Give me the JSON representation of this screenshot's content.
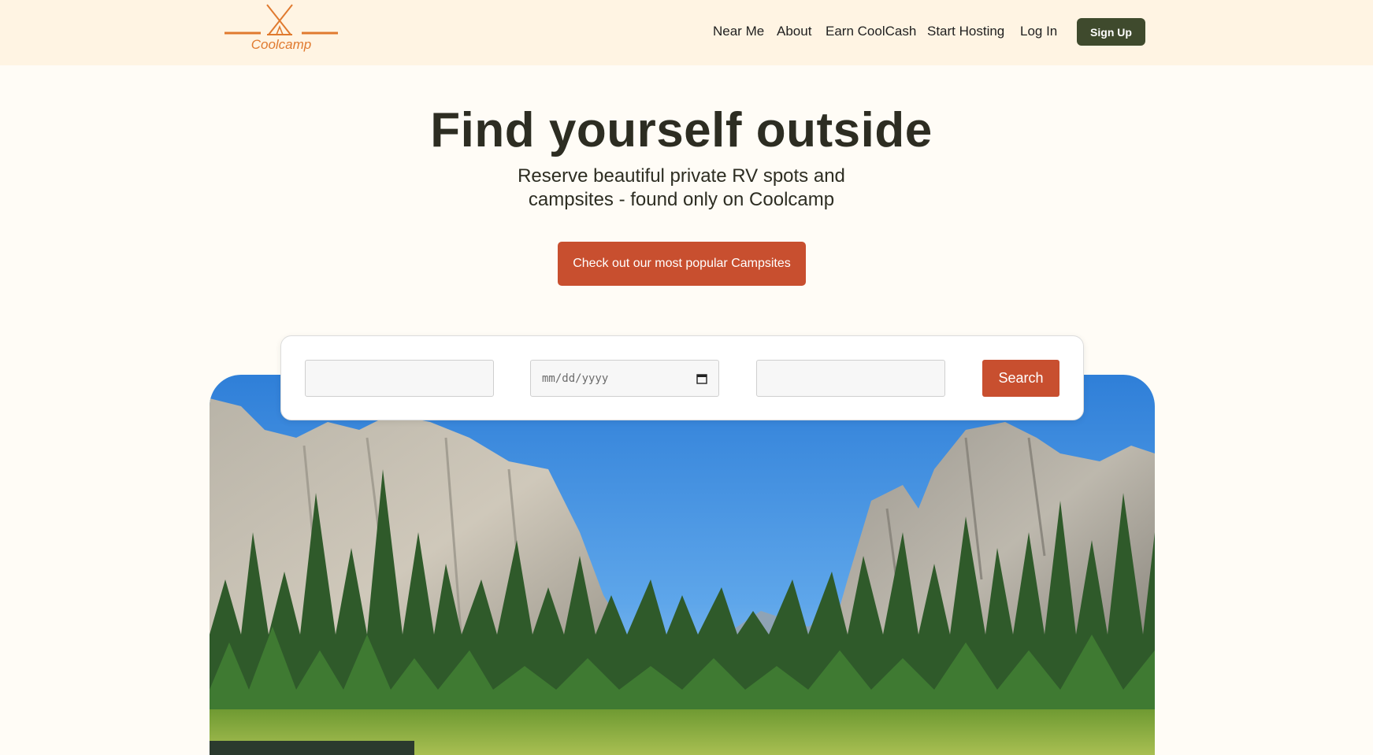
{
  "brand": {
    "name": "Coolcamp",
    "accent": "#e07a2f"
  },
  "nav": {
    "links": [
      "Near Me",
      "About",
      "Earn CoolCash",
      "Start Hosting",
      "Log In"
    ],
    "signup_label": "Sign Up"
  },
  "hero": {
    "title": "Find yourself outside",
    "subtitle_line1": "Reserve beautiful private RV spots and",
    "subtitle_line2": "campsites - found only on Coolcamp",
    "cta_label": "Check out our most popular Campsites"
  },
  "search": {
    "location_value": "",
    "date_placeholder": "mm/dd/yyyy",
    "guests_value": "",
    "button_label": "Search"
  },
  "colors": {
    "header_bg": "#fff4e3",
    "page_bg": "#fffcf6",
    "cta": "#c84f2f",
    "signup_bg": "#3f4a2d"
  }
}
